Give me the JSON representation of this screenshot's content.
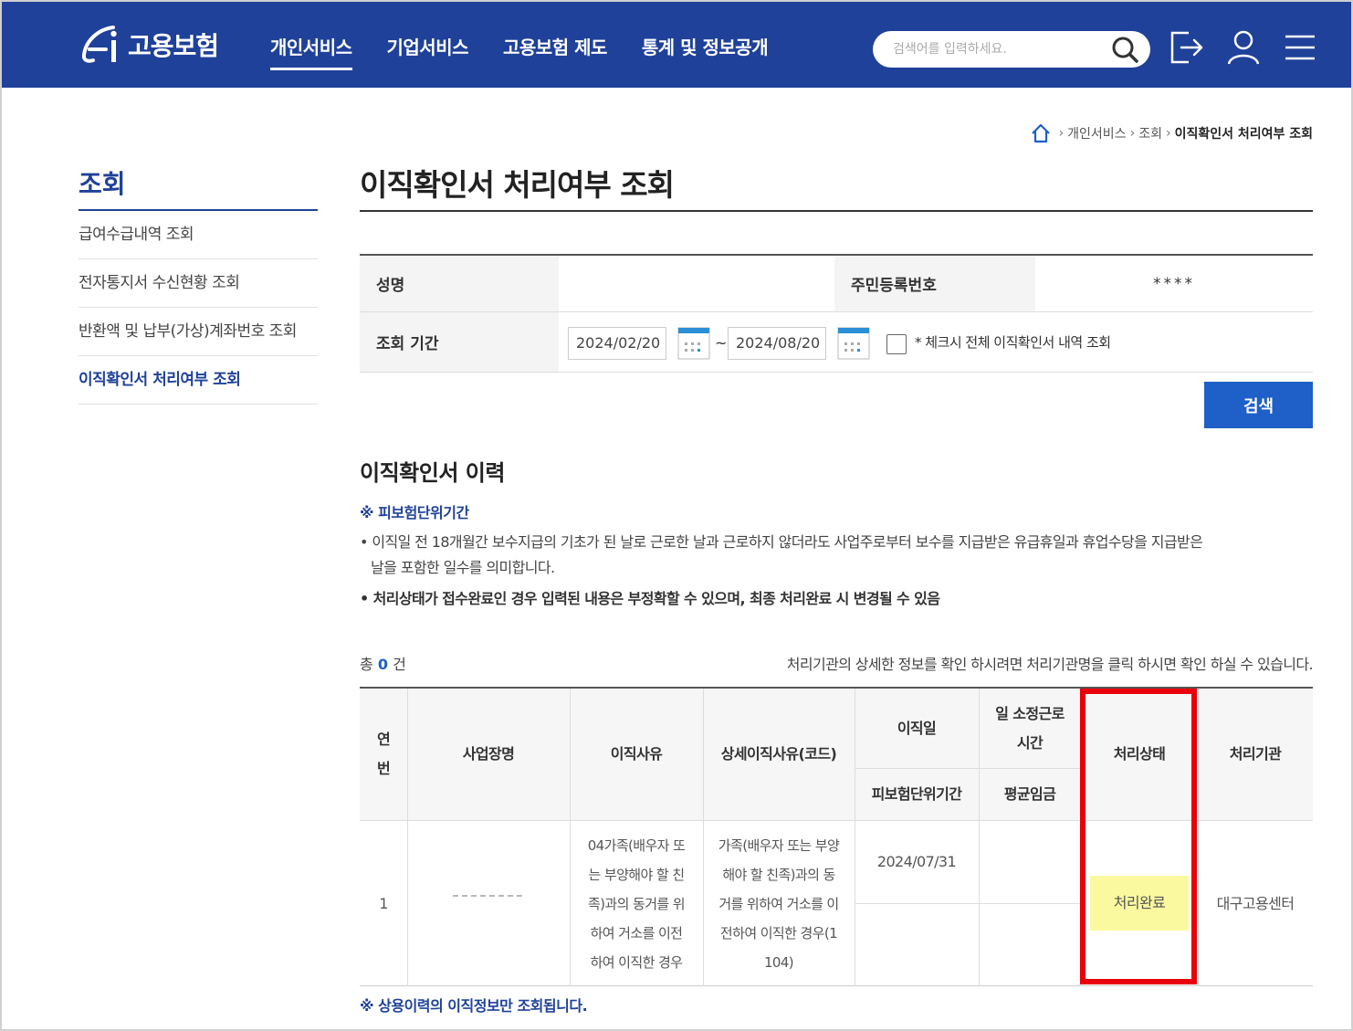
{
  "header": {
    "logo_text": "고용보험",
    "nav": [
      "개인서비스",
      "기업서비스",
      "고용보험 제도",
      "통계 및 정보공개"
    ],
    "search_placeholder": "검색어를 입력하세요."
  },
  "breadcrumb": [
    "개인서비스",
    "조회",
    "이직확인서 처리여부 조회"
  ],
  "sidebar": {
    "title": "조회",
    "items": [
      "급여수급내역 조회",
      "전자통지서 수신현황 조회",
      "반환액 및 납부(가상)계좌번호 조회",
      "이직확인서 처리여부 조회"
    ]
  },
  "page": {
    "title": "이직확인서 처리여부 조회"
  },
  "form": {
    "name_label": "성명",
    "name_value": "",
    "rrn_label": "주민등록번호",
    "rrn_value": "****",
    "period_label": "조회 기간",
    "start_date": "2024/02/20",
    "tilde": "~",
    "end_date": "2024/08/20",
    "checkbox_label": "* 체크시 전체 이직확인서 내역 조회",
    "search_button": "검색"
  },
  "history": {
    "title": "이직확인서 이력",
    "note_head": "※ 피보험단위기간",
    "bullet1_line1": "• 이직일 전 18개월간 보수지급의 기초가 된 날로 근로한 날과 근로하지 않더라도 사업주로부터 보수를 지급받은 유급휴일과 휴업수당을 지급받은",
    "bullet1_line2": "날을 포함한 일수를 의미합니다.",
    "bullet2": "• 처리상태가 접수완료인 경우 입력된 내용은 부정확할 수 있으며, 최종 처리완료 시 변경될 수 있음",
    "count_prefix": "총",
    "count_value": "0",
    "count_suffix": "건",
    "info": "처리기관의 상세한 정보를 확인 하시려면 처리기관명을 클릭 하시면 확인 하실 수 있습니다."
  },
  "table": {
    "headers": {
      "no": "연\n번",
      "company": "사업장명",
      "reason": "이직사유",
      "detail_reason": "상세이직사유(코드)",
      "leave_date": "이직일",
      "insured_period": "피보험단위기간",
      "hours": "일 소정근로\n시간",
      "avg_wage": "평균임금",
      "status": "처리상태",
      "agency": "처리기관"
    },
    "rows": [
      {
        "no": "1",
        "company": "",
        "reason": "04가족(배우자 또\n는 부양해야 할 친\n족)과의 동거를 위\n하여 거소를 이전\n하여 이직한 경우",
        "detail_reason": "가족(배우자 또는 부양\n해야 할 친족)과의 동\n거를 위하여 거소를 이\n전하여 이직한 경우(1\n104)",
        "leave_date": "2024/07/31",
        "insured_period": "",
        "hours": "",
        "avg_wage": "",
        "status": "처리완료",
        "agency": "대구고용센터"
      }
    ]
  },
  "footer_note": "※ 상용이력의 이직정보만 조회됩니다.",
  "colors": {
    "header_bg": "#1f4199",
    "button_bg": "#1e5fc8",
    "status_highlight": "#fbf9a0",
    "callout_border": "#e8000b"
  }
}
